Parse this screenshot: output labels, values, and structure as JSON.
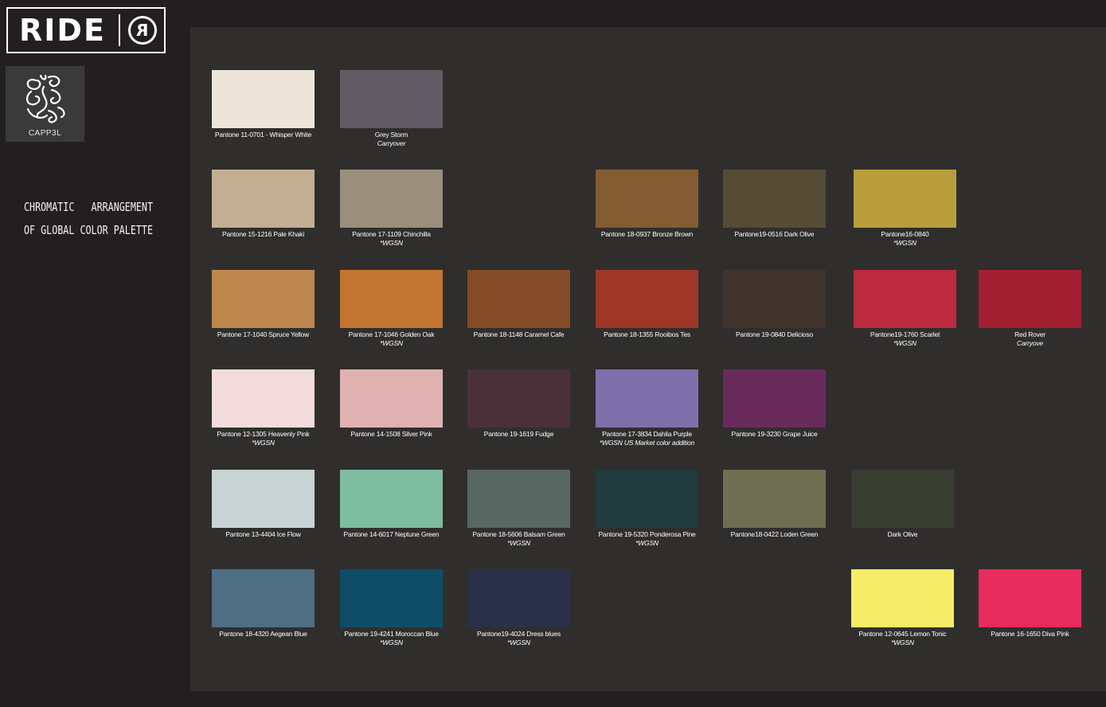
{
  "brand": {
    "ride_text": "RIDE",
    "ride_mark": "R",
    "cappel_label": "CAPP3L"
  },
  "sidebar": {
    "title_line1": "CHROMATIC   ARRANGEMENT",
    "title_line2": "OF GLOBAL COLOR PALETTE"
  },
  "swatches": [
    {
      "name": "Pantone 11-0701 - Whisper White",
      "note": "",
      "color": "#ede5da"
    },
    {
      "name": "Grey Storm",
      "note": "Carryover",
      "color": "#5f5d63"
    },
    {
      "name": "Pantone 15-1216 Pale Khaki",
      "note": "",
      "color": "#c2af93"
    },
    {
      "name": "Pantone 17-1109 Chinchilla",
      "note": "*WGSN",
      "color": "#9a8e7c"
    },
    {
      "name": "Pantone 18-0937 Bronze Brown",
      "note": "",
      "color": "#845c32"
    },
    {
      "name": "Pantone19-0516 Dark Olive",
      "note": "",
      "color": "#564b35"
    },
    {
      "name": "Pantone16-0840",
      "note": "*WGSN",
      "color": "#b89f3b"
    },
    {
      "name": "Pantone 17-1040 Spruce Yellow",
      "note": "",
      "color": "#bd874d"
    },
    {
      "name": "Pantone 17-1046 Golden Oak",
      "note": "*WGSN",
      "color": "#c17531"
    },
    {
      "name": "Pantone 18-1148 Caramel Cafe",
      "note": "",
      "color": "#834c26"
    },
    {
      "name": "Pantone 18-1355 Rooibos Tes",
      "note": "",
      "color": "#9f3628"
    },
    {
      "name": "Pantone 19-0840 Delicioso",
      "note": "",
      "color": "#40322c"
    },
    {
      "name": "Pantone19-1760 Scarlet",
      "note": "*WGSN",
      "color": "#bb2a3f"
    },
    {
      "name": "Red Rover",
      "note": "Carryove",
      "color": "#a21e31"
    },
    {
      "name": "Pantone 12-1305 Heavenly Pink",
      "note": "*WGSN",
      "color": "#f3dddc"
    },
    {
      "name": "Pantone 14-1508 Silver Pink",
      "note": "",
      "color": "#dfb2b1"
    },
    {
      "name": "Pantone 19-1619 Fudge",
      "note": "",
      "color": "#493039"
    },
    {
      "name": "Pantone 17-3834 Dahlia Purple",
      "note": "*WGSN US Market color addition",
      "color": "#7e70aa"
    },
    {
      "name": "Pantone 19-3230 Grape Juice",
      "note": "",
      "color": "#682b5c"
    },
    {
      "name": "Pantone 13-4404 Ice Flow",
      "note": "",
      "color": "#c7d4d3"
    },
    {
      "name": "Pantone 14-6017 Neptune Green",
      "note": "",
      "color": "#7ebd9f"
    },
    {
      "name": "Pantone 18-5606 Balsam Green",
      "note": "*WGSN",
      "color": "#596763"
    },
    {
      "name": "Pantone 19-5320 Ponderosa Pine",
      "note": "*WGSN",
      "color": "#203a3d"
    },
    {
      "name": "Pantone18-0422 Loden Green",
      "note": "",
      "color": "#6c6f52"
    },
    {
      "name": "Dark Olive",
      "note": "",
      "color": "#373d31"
    },
    {
      "name": "Pantone 18-4320 Aegean Blue",
      "note": "",
      "color": "#4f6d83"
    },
    {
      "name": "Pantone 19-4241 Moroccan Blue",
      "note": "*WGSN",
      "color": "#0f4d66"
    },
    {
      "name": "Pantone19-4024 Dress blues",
      "note": "*WGSN",
      "color": "#2a3047"
    },
    {
      "name": "Pantone 12-0645 Lemon Tonic",
      "note": "*WGSN",
      "color": "#f6ec67"
    },
    {
      "name": "Pantone 16-1650 Diva Pink",
      "note": "",
      "color": "#e72b5c"
    }
  ]
}
